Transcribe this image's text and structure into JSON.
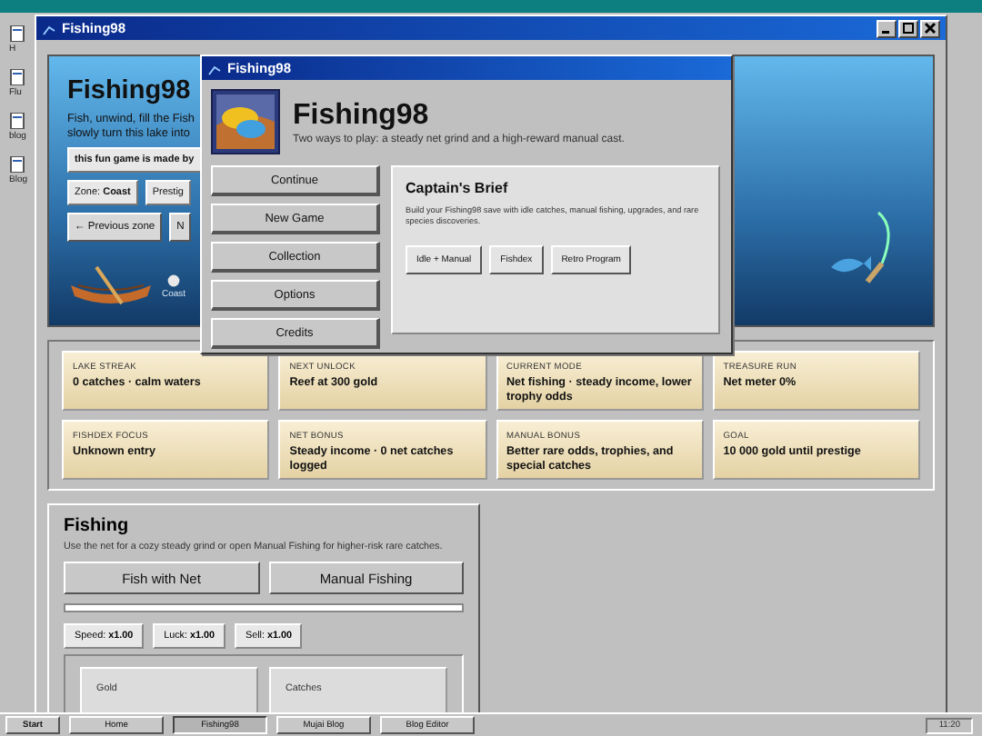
{
  "desktop_icons": [
    {
      "label": "H"
    },
    {
      "label": "Flu"
    },
    {
      "label": "blog"
    },
    {
      "label": "Blog"
    }
  ],
  "window": {
    "title": "Fishing98"
  },
  "hero": {
    "title": "Fishing98",
    "lines": [
      "Fish, unwind, fill the Fish",
      "slowly turn this lake into"
    ],
    "credit": "this fun game is made by",
    "zone_label": "Zone:",
    "zone_value": "Coast",
    "prestige": "Prestig",
    "prev_button": "← Previous zone",
    "next_button": "N",
    "boat_caption": "Coast"
  },
  "dialog": {
    "title": "Fishing98",
    "heading": "Fishing98",
    "subtitle": "Two ways to play: a steady net grind and a high-reward manual cast.",
    "menu": [
      "Continue",
      "New Game",
      "Collection",
      "Options",
      "Credits"
    ],
    "brief": {
      "title": "Captain's Brief",
      "text": "Build your Fishing98 save with idle catches, manual fishing, upgrades, and rare species discoveries.",
      "tags": [
        "Idle + Manual",
        "Fishdex",
        "Retro Program"
      ]
    }
  },
  "stats": [
    {
      "label": "LAKE STREAK",
      "value": "0 catches · calm waters"
    },
    {
      "label": "NEXT UNLOCK",
      "value": "Reef at 300 gold"
    },
    {
      "label": "CURRENT MODE",
      "value": "Net fishing · steady income, lower trophy odds"
    },
    {
      "label": "TREASURE RUN",
      "value": "Net meter 0%"
    },
    {
      "label": "FISHDEX FOCUS",
      "value": "Unknown entry"
    },
    {
      "label": "NET BONUS",
      "value": "Steady income · 0 net catches logged"
    },
    {
      "label": "MANUAL BONUS",
      "value": "Better rare odds, trophies, and special catches"
    },
    {
      "label": "GOAL",
      "value": "10 000 gold until prestige"
    }
  ],
  "fishing": {
    "title": "Fishing",
    "description": "Use the net for a cozy steady grind or open Manual Fishing for higher-risk rare catches.",
    "buttons": [
      "Fish with Net",
      "Manual Fishing"
    ],
    "progress": {
      "level": 0
    },
    "chips": [
      {
        "label": "Speed:",
        "value": "x1.00"
      },
      {
        "label": "Luck:",
        "value": "x1.00"
      },
      {
        "label": "Sell:",
        "value": "x1.00"
      }
    ],
    "cards": [
      {
        "label": "Gold"
      },
      {
        "label": "Catches"
      }
    ]
  },
  "taskbar": {
    "start": "Start",
    "items": [
      {
        "label": "Home",
        "selected": false
      },
      {
        "label": "Fishing98",
        "selected": true
      },
      {
        "label": "Mujai Blog",
        "selected": false
      },
      {
        "label": "Blog Editor",
        "selected": false
      }
    ],
    "clock": "11:20"
  }
}
